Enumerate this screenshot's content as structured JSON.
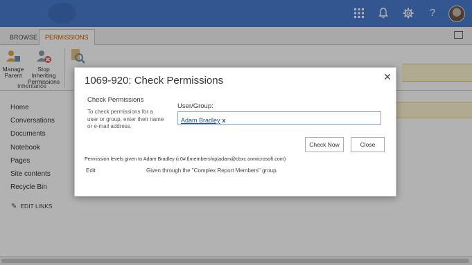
{
  "suite_bar": {
    "icons": [
      "app-launcher-icon",
      "bell-icon",
      "gear-icon",
      "help-icon"
    ],
    "accent_color": "#4a7bd0"
  },
  "ribbon": {
    "tabs": [
      "BROWSE",
      "PERMISSIONS"
    ],
    "active_tab": "PERMISSIONS",
    "buttons": {
      "manage_parent": "Manage Parent",
      "stop_inheriting": "Stop Inheriting Permissions",
      "check_permissions_partial": "Pe"
    },
    "group_label": "Inheritance"
  },
  "nav": {
    "items": [
      "Home",
      "Conversations",
      "Documents",
      "Notebook",
      "Pages",
      "Site contents",
      "Recycle Bin"
    ],
    "edit_links": "EDIT LINKS"
  },
  "dialog": {
    "title": "1069-920: Check Permissions",
    "section_heading": "Check Permissions",
    "section_description": "To check permissions for a user or group, enter their name or e-mail address.",
    "user_group_label": "User/Group:",
    "user_group_value": "Adam Bradley",
    "user_group_remove": "x",
    "check_now_label": "Check Now",
    "close_label": "Close",
    "permission_levels_text": "Permission levels given to Adam Bradley (i:0#.f|membership|adam@cbxc.onmicrosoft.com)",
    "permissions": [
      {
        "level": "Edit",
        "source": "Given through the \"Complex Report Members\" group."
      }
    ]
  }
}
